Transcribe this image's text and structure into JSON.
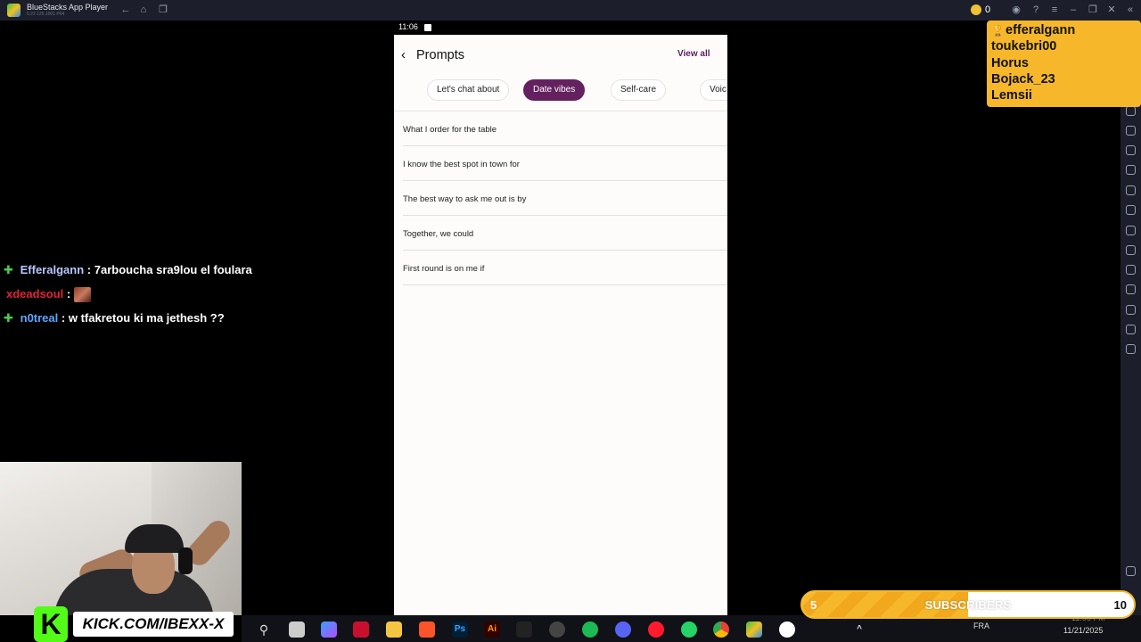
{
  "window": {
    "title": "BlueStacks App Player",
    "version": "5.22.125.1001 P64",
    "coin_count": "0"
  },
  "leaderboard": {
    "entries": [
      "efferalgann",
      "toukebri00",
      "Horus",
      "Bojack_23",
      "Lemsii"
    ]
  },
  "phone": {
    "time": "11:06",
    "title": "Prompts",
    "view_all": "View all",
    "chips": [
      "Let's chat about",
      "Date vibes",
      "Self-care",
      "Voic"
    ],
    "active_chip": "Date vibes",
    "prompts": [
      "What I order for the table",
      "I know the best spot in town for",
      "The best way to ask me out is by",
      "Together, we could",
      "First round is on me if"
    ]
  },
  "chat": {
    "messages": [
      {
        "user": "Efferalgann",
        "text": "7arboucha sra9lou el foulara",
        "badge": "plus-badge"
      },
      {
        "user": "xdeadsoul",
        "text": "",
        "emote": "emote"
      },
      {
        "user": "n0treal",
        "text": "w tfakretou ki ma jethesh ??",
        "badge": "plus-badge"
      }
    ],
    "separator": ":"
  },
  "kick": {
    "logo_letter": "K",
    "url": "KICK.COM/IBEXX-X"
  },
  "subgoal": {
    "current": "5",
    "label": "SUBSCRIBERS",
    "target": "10",
    "progress": 0.5
  },
  "taskbar": {
    "language": "FRA",
    "time": "11:06 PM",
    "date": "11/21/2025"
  },
  "colors": {
    "accent_purple": "#64215f",
    "leaderboard_bg": "#f6b82a",
    "kick_green": "#53fc18"
  }
}
